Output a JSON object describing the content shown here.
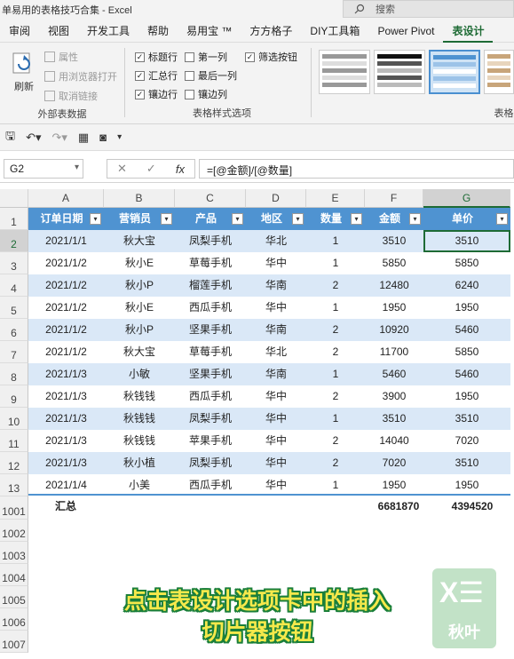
{
  "window": {
    "title": "单易用的表格技巧合集 - Excel",
    "search_placeholder": "搜索"
  },
  "tabs": [
    "审阅",
    "视图",
    "开发工具",
    "帮助",
    "易用宝 ™",
    "方方格子",
    "DIY工具箱",
    "Power Pivot",
    "表设计"
  ],
  "ribbon": {
    "external": {
      "refresh": "刷新",
      "properties": "属性",
      "open_browser": "用浏览器打开",
      "unlink": "取消链接",
      "group": "外部表数据"
    },
    "style_options": {
      "header_row": "标题行",
      "total_row": "汇总行",
      "banded_rows": "镶边行",
      "first_column": "第一列",
      "last_column": "最后一列",
      "banded_columns": "镶边列",
      "filter_button": "筛选按钮",
      "group": "表格样式选项",
      "checked": {
        "header_row": true,
        "total_row": true,
        "banded_rows": true,
        "first_column": false,
        "last_column": false,
        "banded_columns": false,
        "filter_button": true
      }
    },
    "styles_group": "表格"
  },
  "formula_bar": {
    "name_box": "G2",
    "formula": "=[@金额]/[@数量]"
  },
  "columns": [
    "A",
    "B",
    "C",
    "D",
    "E",
    "F",
    "G"
  ],
  "table": {
    "headers": [
      "订单日期",
      "营销员",
      "产品",
      "地区",
      "数量",
      "金额",
      "单价"
    ],
    "rows": [
      [
        "2021/1/1",
        "秋大宝",
        "凤梨手机",
        "华北",
        "1",
        "3510",
        "3510"
      ],
      [
        "2021/1/2",
        "秋小E",
        "草莓手机",
        "华中",
        "1",
        "5850",
        "5850"
      ],
      [
        "2021/1/2",
        "秋小P",
        "榴莲手机",
        "华南",
        "2",
        "12480",
        "6240"
      ],
      [
        "2021/1/2",
        "秋小E",
        "西瓜手机",
        "华中",
        "1",
        "1950",
        "1950"
      ],
      [
        "2021/1/2",
        "秋小P",
        "坚果手机",
        "华南",
        "2",
        "10920",
        "5460"
      ],
      [
        "2021/1/2",
        "秋大宝",
        "草莓手机",
        "华北",
        "2",
        "11700",
        "5850"
      ],
      [
        "2021/1/3",
        "小敏",
        "坚果手机",
        "华南",
        "1",
        "5460",
        "5460"
      ],
      [
        "2021/1/3",
        "秋钱钱",
        "西瓜手机",
        "华中",
        "2",
        "3900",
        "1950"
      ],
      [
        "2021/1/3",
        "秋钱钱",
        "凤梨手机",
        "华中",
        "1",
        "3510",
        "3510"
      ],
      [
        "2021/1/3",
        "秋钱钱",
        "苹果手机",
        "华中",
        "2",
        "14040",
        "7020"
      ],
      [
        "2021/1/3",
        "秋小植",
        "凤梨手机",
        "华中",
        "2",
        "7020",
        "3510"
      ],
      [
        "2021/1/4",
        "小美",
        "西瓜手机",
        "华中",
        "1",
        "1950",
        "1950"
      ]
    ],
    "total": {
      "label": "汇总",
      "amount": "6681870",
      "unit_price": "4394520"
    }
  },
  "row_numbers": [
    "1",
    "2",
    "3",
    "4",
    "5",
    "6",
    "7",
    "8",
    "9",
    "10",
    "11",
    "12",
    "13",
    "1001",
    "1002",
    "1003",
    "1004",
    "1005",
    "1006",
    "1007"
  ],
  "caption": {
    "line1": "点击表设计选项卡中的插入",
    "line2": "切片器按钮"
  },
  "watermark": {
    "brand": "秋叶"
  },
  "colors": {
    "header_blue": "#4f93d1",
    "band_blue": "#dae8f7",
    "accent_green": "#1e6b35",
    "caption_yellow": "#f6e94b"
  }
}
